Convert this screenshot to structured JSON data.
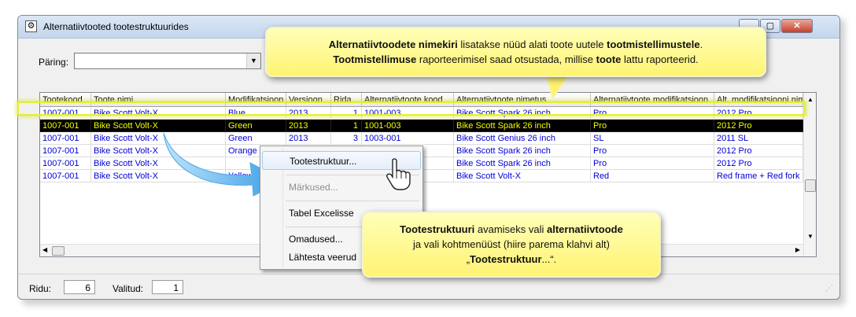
{
  "window": {
    "title": "Alternatiivtooted tootestruktuurides",
    "buttons": {
      "minimize": "▁",
      "maximize": "▢",
      "close": "✕"
    }
  },
  "query": {
    "label": "Päring:",
    "value": ""
  },
  "grid": {
    "columns": [
      "Tootekood",
      "Toote nimi",
      "Modifikatsioon",
      "Versioon",
      "Rida",
      "Alternatiivtoote kood",
      "Alternatiivtoote nimetus",
      "Alternatiivtoote modifikatsioon",
      "Alt. modifikatsiooni nimetus"
    ],
    "rows": [
      [
        "1007-001",
        "Bike Scott Volt-X",
        "Blue",
        "2013",
        "1",
        "1001-003",
        "Bike Scott Spark 26 inch",
        "Pro",
        "2012 Pro"
      ],
      [
        "1007-001",
        "Bike Scott Volt-X",
        "Green",
        "2013",
        "1",
        "1001-003",
        "Bike Scott Spark 26 inch",
        "Pro",
        "2012 Pro"
      ],
      [
        "1007-001",
        "Bike Scott Volt-X",
        "Green",
        "2013",
        "3",
        "1003-001",
        "Bike Scott Genius 26 inch",
        "SL",
        "2011 SL"
      ],
      [
        "1007-001",
        "Bike Scott Volt-X",
        "Orange",
        "",
        "",
        "",
        "Bike Scott Spark 26 inch",
        "Pro",
        "2012 Pro"
      ],
      [
        "1007-001",
        "Bike Scott Volt-X",
        "",
        "",
        "",
        "",
        "Bike Scott Spark 26 inch",
        "Pro",
        "2012 Pro"
      ],
      [
        "1007-001",
        "Bike Scott Volt-X",
        "Yellow",
        "",
        "",
        "",
        "Bike Scott Volt-X",
        "Red",
        "Red frame + Red fork"
      ]
    ],
    "selected_row": 1
  },
  "context_menu": {
    "items": [
      "Tootestruktuur...",
      "Märkused...",
      "Tabel Excelisse",
      "Omadused...",
      "Lähtesta veerud"
    ]
  },
  "status": {
    "rows_label": "Ridu:",
    "rows_value": "6",
    "selected_label": "Valitud:",
    "selected_value": "1"
  },
  "callouts": {
    "top": {
      "l1_b1": "Alternatiivtoodete nimekiri",
      "l1_t1": " lisatakse nüüd alati toote uutele ",
      "l1_b2": "tootmistellimustele",
      "l1_t2": ".",
      "l2_b1": "Tootmistellimuse",
      "l2_t1": " raporteerimisel saad otsustada, millise ",
      "l2_b2": "toote",
      "l2_t2": " lattu raporteerid."
    },
    "bottom": {
      "l1_b1": "Tootestruktuuri",
      "l1_t1": " avamiseks vali ",
      "l1_b2": "alternatiivtoode",
      "l2": "ja vali kohtmenüüst (hiire parema klahvi alt)",
      "l3_t1": "„",
      "l3_b1": "Tootestruktuur",
      "l3_t2": "...“."
    }
  },
  "colors": {
    "link_text": "#0000d8",
    "selected_text": "#f4ff00",
    "callout": "#fff373",
    "arrow": "#3a9ee6"
  }
}
